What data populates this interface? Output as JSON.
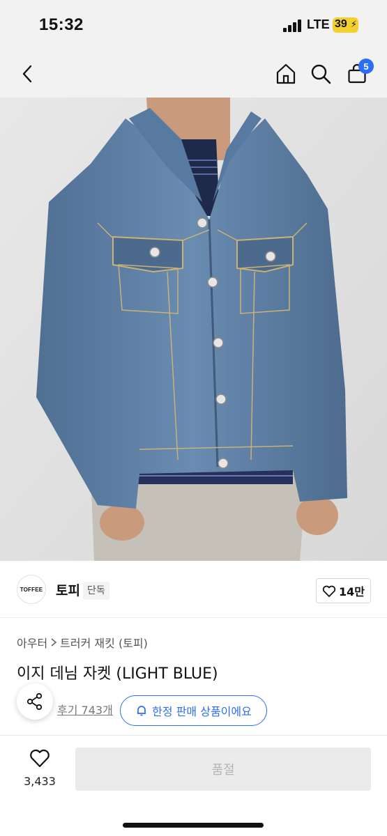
{
  "status_bar": {
    "time": "15:32",
    "network": "LTE",
    "battery": "39"
  },
  "header": {
    "cart_count": "5"
  },
  "product_image": {
    "alt": "model wearing light blue denim trucker jacket"
  },
  "brand": {
    "logo_text": "TOFFEE",
    "name": "토피",
    "tag": "단독",
    "likes": "14만"
  },
  "breadcrumb": {
    "category": "아우터",
    "subcategory": "트러커 재킷 (토피)"
  },
  "product": {
    "title": "이지 데님 자켓 (LIGHT BLUE)",
    "reviews": "후기 743개",
    "limited_label": "한정 판매 상품이에요"
  },
  "bottom": {
    "wish_count": "3,433",
    "soldout_label": "품절"
  },
  "colors": {
    "accent": "#2d6df6",
    "battery": "#f3d02f",
    "denim": "#5d7fa3"
  }
}
